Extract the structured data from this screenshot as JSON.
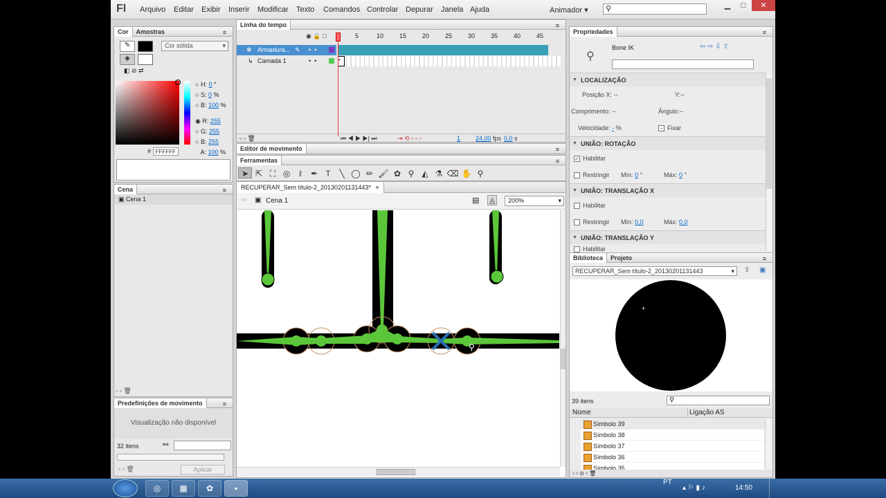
{
  "app": {
    "logo": "Fl",
    "workspace": "Animador"
  },
  "menu": [
    "Arquivo",
    "Editar",
    "Exibir",
    "Inserir",
    "Modificar",
    "Texto",
    "Comandos",
    "Controlar",
    "Depurar",
    "Janela",
    "Ajuda"
  ],
  "window_controls": {
    "minimize": "▁",
    "maximize": "□",
    "close": "✕"
  },
  "color_panel": {
    "tab_active": "Cor",
    "tab_other": "Amostras",
    "fill_type": "Cor sólida",
    "h_label": "H:",
    "h_value": "0",
    "h_unit": "°",
    "s_label": "S:",
    "s_value": "0",
    "s_unit": "%",
    "b_label": "B:",
    "b_value": "100",
    "b_unit": "%",
    "r_label": "R:",
    "r_value": "255",
    "g_label": "G:",
    "g_value": "255",
    "bl_label": "B:",
    "bl_value": "255",
    "a_label": "A:",
    "a_value": "100",
    "a_unit": "%",
    "hex_label": "#",
    "hex_value": "FFFFFF"
  },
  "scene_panel": {
    "tab": "Cena",
    "items": [
      "Cena 1"
    ]
  },
  "motion_presets": {
    "tab": "Predefinições de movimento",
    "preview": "Visualização não disponível",
    "count": "32 itens",
    "apply": "Aplicar"
  },
  "timeline": {
    "tab": "Linha do tempo",
    "frame_numbers": [
      "1",
      "5",
      "10",
      "15",
      "20",
      "25",
      "30",
      "35",
      "40",
      "45"
    ],
    "layers": [
      {
        "name": "Armadura...",
        "selected": true
      },
      {
        "name": "Camada 1",
        "selected": false
      }
    ],
    "status": {
      "frame": "1",
      "fps": "24,00",
      "fps_unit": "fps",
      "time": "0,0",
      "time_unit": "s"
    }
  },
  "motion_editor": {
    "tab": "Editor de movimento"
  },
  "tools_panel": {
    "tab": "Ferramentas"
  },
  "document": {
    "tab": "RECUPERAR_Sem título-2_20130201131443*",
    "scene": "Cena 1",
    "zoom": "200%"
  },
  "properties": {
    "tab": "Propriedades",
    "object_type": "Bone IK",
    "sections": {
      "location": "LOCALIZAÇÃO",
      "rotation": "UNIÃO: ROTAÇÃO",
      "trans_x": "UNIÃO: TRANSLAÇÃO X",
      "trans_y": "UNIÃO: TRANSLAÇÃO Y"
    },
    "pos_x": "Posição X: --",
    "pos_y": "Y:--",
    "length": "Comprimento: --",
    "angle": "Ângulo:--",
    "speed_label": "Velocidade:",
    "speed_value": "-",
    "speed_unit": "%",
    "fix": "Fixar",
    "enable": "Habilitar",
    "restrict": "Restringir",
    "min_label": "Mín:",
    "max_label": "Máx:",
    "rot_min": "0",
    "rot_max": "0",
    "deg": "°",
    "tx_min": "0,0",
    "tx_max": "0,0"
  },
  "library": {
    "tab_active": "Biblioteca",
    "tab_other": "Projeto",
    "document": "RECUPERAR_Sem título-2_20130201131443",
    "count": "39 itens",
    "col_name": "Nome",
    "col_linkage": "Ligação AS",
    "items": [
      "Símbolo 39",
      "Símbolo 38",
      "Símbolo 37",
      "Símbolo 36",
      "Símbolo 35"
    ]
  },
  "taskbar": {
    "lang": "PT",
    "time": "14:50"
  },
  "colors": {
    "accent_layer": "#3aa0b8",
    "bone_green": "#5cc63a",
    "selection_blue": "#2a6fb0"
  }
}
